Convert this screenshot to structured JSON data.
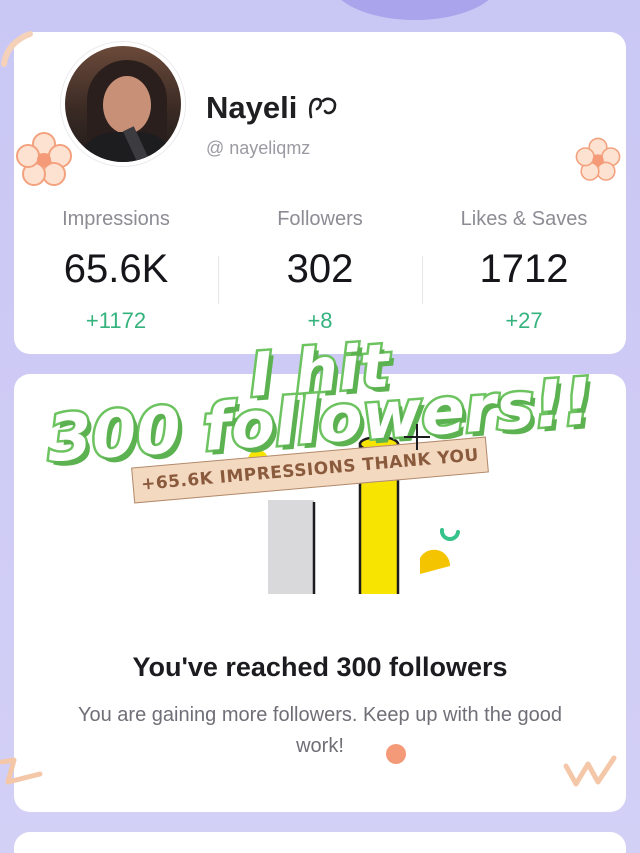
{
  "profile": {
    "name": "Nayeli",
    "handle": "@ nayeliqmz"
  },
  "stats": [
    {
      "label": "Impressions",
      "value": "65.6K",
      "delta": "+1172"
    },
    {
      "label": "Followers",
      "value": "302",
      "delta": "+8"
    },
    {
      "label": "Likes & Saves",
      "value": "1712",
      "delta": "+27"
    }
  ],
  "milestone": {
    "title": "You've reached 300 followers",
    "subtitle": "You are gaining more followers. Keep up with the good work!"
  },
  "overlay": {
    "line1": "I hit",
    "line2": "300 followers!!",
    "banner": "+65.6K IMPRESSIONS THANK YOU"
  },
  "colors": {
    "background": "#cdcaf5",
    "accent_green": "#35b37e",
    "overlay_green": "#6cc35f",
    "highlight_yellow": "#f7e400",
    "banner_peach": "#f4d9c1"
  },
  "icons": [
    "verified-badge-icon",
    "flower-decoration-icon",
    "sparkle-icon",
    "squiggle-decoration-icon"
  ]
}
